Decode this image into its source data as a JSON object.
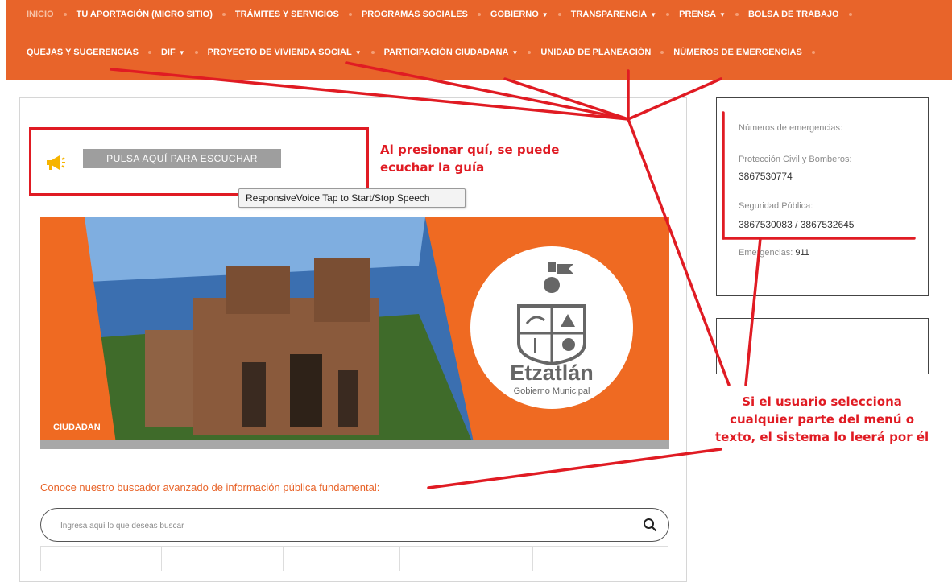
{
  "nav": {
    "row1": [
      {
        "label": "INICIO",
        "active": true,
        "caret": false
      },
      {
        "label": "TU APORTACIÓN (MICRO SITIO)",
        "active": false,
        "caret": false
      },
      {
        "label": "TRÁMITES Y SERVICIOS",
        "active": false,
        "caret": false
      },
      {
        "label": "PROGRAMAS SOCIALES",
        "active": false,
        "caret": false
      },
      {
        "label": "GOBIERNO",
        "active": false,
        "caret": true
      },
      {
        "label": "TRANSPARENCIA",
        "active": false,
        "caret": true
      },
      {
        "label": "PRENSA",
        "active": false,
        "caret": true
      },
      {
        "label": "BOLSA DE TRABAJO",
        "active": false,
        "caret": false
      }
    ],
    "row2": [
      {
        "label": "QUEJAS Y SUGERENCIAS",
        "caret": false
      },
      {
        "label": "DIF",
        "caret": true
      },
      {
        "label": "PROYECTO DE VIVIENDA SOCIAL",
        "caret": true
      },
      {
        "label": "PARTICIPACIÓN CIUDADANA",
        "caret": true
      },
      {
        "label": "UNIDAD DE PLANEACIÓN",
        "caret": false
      },
      {
        "label": "NÚMEROS DE EMERGENCIAS",
        "caret": false
      }
    ],
    "caret_glyph": "▼"
  },
  "speech": {
    "button_label": "PULSA AQUÍ PARA ESCUCHAR",
    "tooltip": "ResponsiveVoice Tap to Start/Stop Speech",
    "icon": "megaphone-icon"
  },
  "banner": {
    "label": "CIUDADAN",
    "municipality": "Etzatlán",
    "subtitle": "Gobierno Municipal"
  },
  "search": {
    "title": "Conoce nuestro buscador avanzado de información pública fundamental:",
    "placeholder": "Ingresa aquí lo que deseas buscar",
    "icon": "search-icon"
  },
  "sidebar": {
    "heading": "Números de emergencias:",
    "items": [
      {
        "label": "Protección Civil y Bomberos:",
        "number": "3867530774"
      },
      {
        "label": "Seguridad Pública:",
        "number": "3867530083 / 3867532645"
      }
    ],
    "emergency_label": "Emergencias:",
    "emergency_number": "911"
  },
  "annotations": {
    "speech_note": "Al presionar quí, se puede\necuchar la guía",
    "menu_note": "Si el usuario selecciona\ncualquier parte del menú o\ntexto, el sistema lo leerá por él"
  },
  "colors": {
    "nav_bg": "#e8642a",
    "annotation_red": "#e01b23",
    "search_title": "#e8642a"
  }
}
